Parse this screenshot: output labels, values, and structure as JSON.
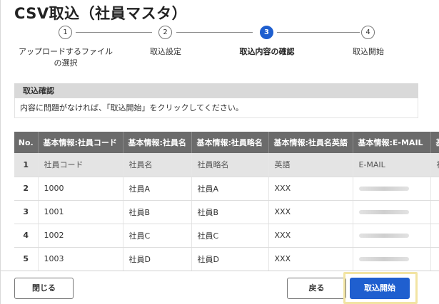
{
  "title": "CSV取込（社員マスタ）",
  "stepper": {
    "steps": [
      {
        "number": "1",
        "label_line1": "アップロードするファイル",
        "label_line2": "の選択"
      },
      {
        "number": "2",
        "label_line1": "取込設定",
        "label_line2": ""
      },
      {
        "number": "3",
        "label_line1": "取込内容の確認",
        "label_line2": ""
      },
      {
        "number": "4",
        "label_line1": "取込開始",
        "label_line2": ""
      }
    ],
    "active_step": 3
  },
  "confirm": {
    "section_title": "取込確認",
    "message": "内容に問題がなければ、「取込開始」をクリックしてください。"
  },
  "table": {
    "columns": [
      "No.",
      "基本情報:社員コード",
      "基本情報:社員名",
      "基本情報:社員略名",
      "基本情報:社員名英語",
      "基本情報:E-MAIL",
      "基"
    ],
    "rows": [
      {
        "no": "1",
        "code": "社員コード",
        "name": "社員名",
        "short": "社員略名",
        "english": "英語",
        "email": "E-MAIL",
        "extra": "社"
      },
      {
        "no": "2",
        "code": "1000",
        "name": "社員A",
        "short": "社員A",
        "english": "XXX",
        "email": "",
        "extra": ""
      },
      {
        "no": "3",
        "code": "1001",
        "name": "社員B",
        "short": "社員B",
        "english": "XXX",
        "email": "",
        "extra": ""
      },
      {
        "no": "4",
        "code": "1002",
        "name": "社員C",
        "short": "社員C",
        "english": "XXX",
        "email": "",
        "extra": ""
      },
      {
        "no": "5",
        "code": "1003",
        "name": "社員D",
        "short": "社員D",
        "english": "XXX",
        "email": "",
        "extra": ""
      }
    ]
  },
  "footer": {
    "close_label": "閉じる",
    "back_label": "戻る",
    "start_label": "取込開始"
  },
  "colors": {
    "accent": "#1f5fcf",
    "table_header": "#6b6b6b",
    "highlight": "#f2e4a3"
  }
}
